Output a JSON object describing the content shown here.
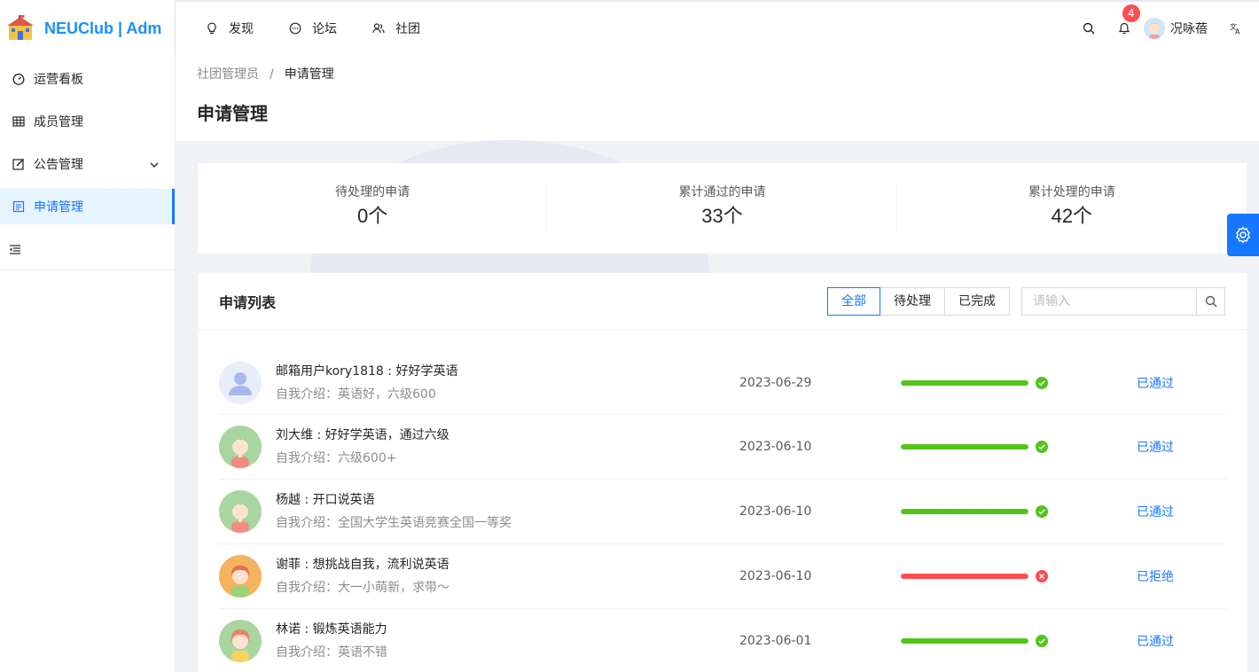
{
  "app": {
    "logo_text": "NEUClub | Adm"
  },
  "sidebar": {
    "items": [
      {
        "label": "运营看板",
        "icon": "dashboard-icon"
      },
      {
        "label": "成员管理",
        "icon": "table-icon"
      },
      {
        "label": "公告管理",
        "icon": "edit-icon",
        "has_children": true
      },
      {
        "label": "申请管理",
        "icon": "profile-icon",
        "active": true
      }
    ]
  },
  "header": {
    "nav": [
      {
        "label": "发现",
        "icon": "bulb-icon"
      },
      {
        "label": "论坛",
        "icon": "message-icon"
      },
      {
        "label": "社团",
        "icon": "team-icon"
      }
    ],
    "notification_count": "4",
    "user_name": "况咏蓓"
  },
  "page": {
    "breadcrumb": [
      "社团管理员",
      "/",
      "申请管理"
    ],
    "title": "申请管理"
  },
  "stats": [
    {
      "label": "待处理的申请",
      "value": "0个"
    },
    {
      "label": "累计通过的申请",
      "value": "33个"
    },
    {
      "label": "累计处理的申请",
      "value": "42个"
    }
  ],
  "list": {
    "title": "申请列表",
    "filters": [
      {
        "label": "全部",
        "active": true
      },
      {
        "label": "待处理",
        "active": false
      },
      {
        "label": "已完成",
        "active": false
      }
    ],
    "search_placeholder": "请输入",
    "rows": [
      {
        "title": "邮箱用户kory1818 : 好好学英语",
        "desc": "自我介绍：英语好，六级600",
        "date": "2023-06-29",
        "progress": 100,
        "status": "success",
        "action": "已通过",
        "avatar": "default"
      },
      {
        "title": "刘大维 : 好好学英语，通过六级",
        "desc": "自我介绍：六级600+",
        "date": "2023-06-10",
        "progress": 100,
        "status": "success",
        "action": "已通过",
        "avatar": "green"
      },
      {
        "title": "杨越 : 开口说英语",
        "desc": "自我介绍：全国大学生英语竞赛全国一等奖",
        "date": "2023-06-10",
        "progress": 100,
        "status": "success",
        "action": "已通过",
        "avatar": "green"
      },
      {
        "title": "谢菲 : 想挑战自我，流利说英语",
        "desc": "自我介绍：大一小萌新，求带～",
        "date": "2023-06-10",
        "progress": 100,
        "status": "exception",
        "action": "已拒绝",
        "avatar": "orange"
      },
      {
        "title": "林诺 : 锻炼英语能力",
        "desc": "自我介绍：英语不错",
        "date": "2023-06-01",
        "progress": 100,
        "status": "success",
        "action": "已通过",
        "avatar": "girl"
      }
    ]
  },
  "colors": {
    "primary": "#1677ff",
    "success": "#52c41a",
    "exception": "#ff4d4f"
  }
}
